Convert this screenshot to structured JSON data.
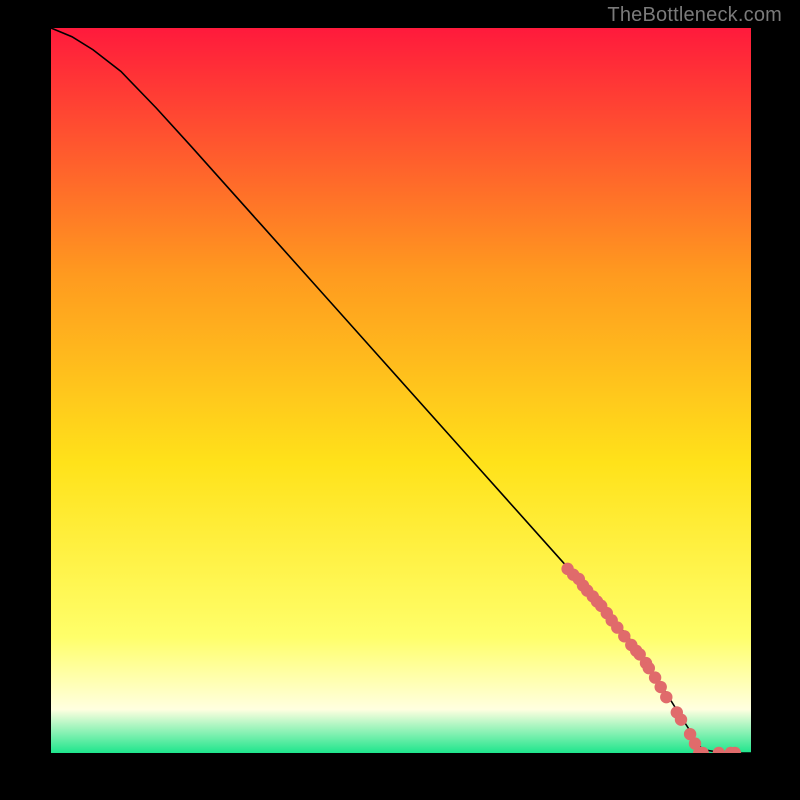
{
  "attribution": "TheBottleneck.com",
  "colors": {
    "background": "#000000",
    "curve": "#000000",
    "marker_fill": "#e06b6b",
    "marker_stroke": "#c24f4f",
    "gradient_top": "#ff1a3c",
    "gradient_mid_upper": "#ff9a1f",
    "gradient_mid": "#ffe21a",
    "gradient_mid_lower": "#ffff6a",
    "gradient_pale": "#ffffe0",
    "gradient_bottom": "#1ee58c"
  },
  "chart_data": {
    "type": "line",
    "title": "",
    "xlabel": "",
    "ylabel": "",
    "xlim": [
      0,
      100
    ],
    "ylim": [
      0,
      100
    ],
    "curve": {
      "x": [
        0,
        3,
        6,
        10,
        15,
        20,
        30,
        40,
        50,
        60,
        70,
        75,
        80,
        83,
        85,
        88,
        90,
        93,
        96,
        100
      ],
      "y": [
        100,
        98.8,
        97.0,
        94.0,
        89.0,
        83.7,
        72.9,
        62.1,
        51.3,
        40.5,
        29.7,
        24.3,
        18.9,
        15.3,
        12.6,
        8.1,
        5.0,
        0.5,
        0.0,
        0.0
      ]
    },
    "markers": {
      "x": [
        73.8,
        74.6,
        75.4,
        76.0,
        76.6,
        77.4,
        78.0,
        78.6,
        79.4,
        80.1,
        80.9,
        81.9,
        82.9,
        83.6,
        84.1,
        85.0,
        85.4,
        86.3,
        87.1,
        87.9,
        89.4,
        90.0,
        91.3,
        92.0,
        92.6,
        93.1,
        95.4,
        97.1,
        97.7
      ],
      "y": [
        25.4,
        24.6,
        24.0,
        23.1,
        22.4,
        21.6,
        20.9,
        20.3,
        19.3,
        18.3,
        17.3,
        16.1,
        14.9,
        14.1,
        13.6,
        12.4,
        11.7,
        10.4,
        9.1,
        7.7,
        5.6,
        4.6,
        2.6,
        1.3,
        0.0,
        0.0,
        0.0,
        0.0,
        0.0
      ]
    }
  }
}
